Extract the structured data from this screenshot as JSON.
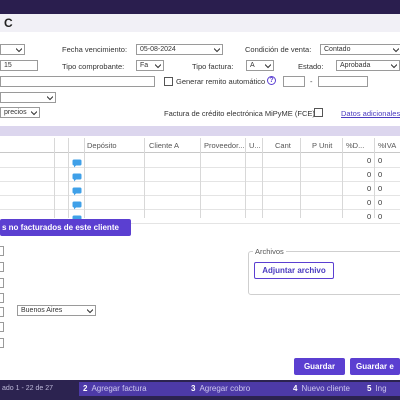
{
  "header": {
    "title": "C"
  },
  "form": {
    "fecha_vencimiento": {
      "label": "Fecha vencimiento:",
      "value": "05-08-2024"
    },
    "condicion_venta": {
      "label": "Condición de venta:",
      "value": "Contado"
    },
    "numero_fragment": "15",
    "tipo_comprobante": {
      "label": "Tipo comprobante:",
      "value": "Fa"
    },
    "tipo_factura": {
      "label": "Tipo factura:",
      "value": "A"
    },
    "estado": {
      "label": "Estado:",
      "value": "Aprobada"
    },
    "generar_remito": {
      "label": "Generar remito automático",
      "help": "?"
    },
    "separator": "-",
    "lista_precios_fragment": "precios",
    "fce": {
      "label": "Factura de crédito electrónica MiPyME (FCE)"
    },
    "datos_adicionales": "Datos adicionales..."
  },
  "grid": {
    "headers": [
      "Depósito",
      "Cliente A",
      "Proveedor...",
      "U...",
      "Cant",
      "P Unit",
      "%D...",
      "%IVA"
    ],
    "rows": [
      {
        "d": "0",
        "iva": "0"
      },
      {
        "d": "0",
        "iva": "0"
      },
      {
        "d": "0",
        "iva": "0"
      },
      {
        "d": "0",
        "iva": "0"
      },
      {
        "d": "0",
        "iva": "0"
      }
    ]
  },
  "buttons": {
    "no_facturados": "s no facturados de este cliente",
    "adjuntar": "Adjuntar archivo",
    "guardar": "Guardar",
    "guardar_e": "Guardar e"
  },
  "archivos": {
    "legend": "Archivos"
  },
  "provincia": {
    "value": "Buenos Aires"
  },
  "taskbar": {
    "status": "ado 1 - 22 de 27",
    "items": [
      {
        "label": "Agregar factura",
        "num": "2"
      },
      {
        "label": "Agregar cobro",
        "num": "3"
      },
      {
        "label": "Nuevo cliente",
        "num": "4"
      },
      {
        "label": "Ing",
        "num": "5"
      }
    ]
  },
  "colors": {
    "accent": "#5b3fd1",
    "band": "#dcd6ee",
    "backdrop": "#3a2a5e"
  },
  "icons": {
    "chat": "chat-bubble-icon",
    "caret": "chevron-down-icon",
    "help": "help-circle-icon"
  }
}
